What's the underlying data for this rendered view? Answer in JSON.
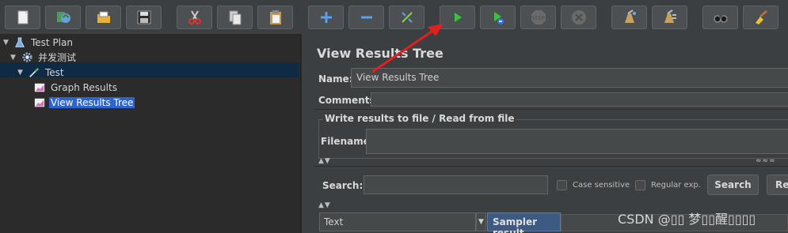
{
  "toolbar": {
    "buttons": [
      {
        "name": "new-icon"
      },
      {
        "name": "templates-icon"
      },
      {
        "name": "open-icon"
      },
      {
        "name": "save-icon"
      },
      {
        "name": "cut-icon"
      },
      {
        "name": "copy-icon"
      },
      {
        "name": "paste-icon"
      },
      {
        "name": "expand-icon"
      },
      {
        "name": "collapse-icon"
      },
      {
        "name": "toggle-icon"
      },
      {
        "name": "start-icon"
      },
      {
        "name": "start-no-pauses-icon"
      },
      {
        "name": "stop-icon"
      },
      {
        "name": "shutdown-icon"
      },
      {
        "name": "clear-icon"
      },
      {
        "name": "clear-all-icon"
      },
      {
        "name": "search-icon"
      },
      {
        "name": "reset-search-icon"
      }
    ],
    "stop_label": "STOP"
  },
  "tree": {
    "items": [
      {
        "label": "Test Plan",
        "level": 0,
        "expanded": true,
        "icon": "flask-icon"
      },
      {
        "label": "并发测试",
        "level": 1,
        "expanded": true,
        "icon": "gear-icon"
      },
      {
        "label": "Test",
        "level": 2,
        "expanded": true,
        "icon": "pipette-icon"
      },
      {
        "label": "Graph Results",
        "level": 3,
        "icon": "graph-icon"
      },
      {
        "label": "View Results Tree",
        "level": 3,
        "icon": "graph-icon",
        "selected": true
      }
    ]
  },
  "panel": {
    "title": "View Results Tree",
    "name_label": "Name:",
    "name_value": "View Results Tree",
    "comments_label": "Comments:",
    "group_title": "Write results to file / Read from file",
    "filename_label": "Filename",
    "filename_value": "",
    "search_label": "Search:",
    "search_value": "",
    "case_sensitive_label": "Case sensitive",
    "regular_exp_label": "Regular exp.",
    "search_button": "Search",
    "reset_button": "Re",
    "renderer_value": "Text",
    "tab_sampler_result": "Sampler result"
  },
  "watermark": "CSDN @▯▯ 梦▯▯醒▯▯▯▯",
  "colors": {
    "accent_arrow": "#e02020",
    "selection": "#2f65ca",
    "tab": "#3d5a83"
  }
}
